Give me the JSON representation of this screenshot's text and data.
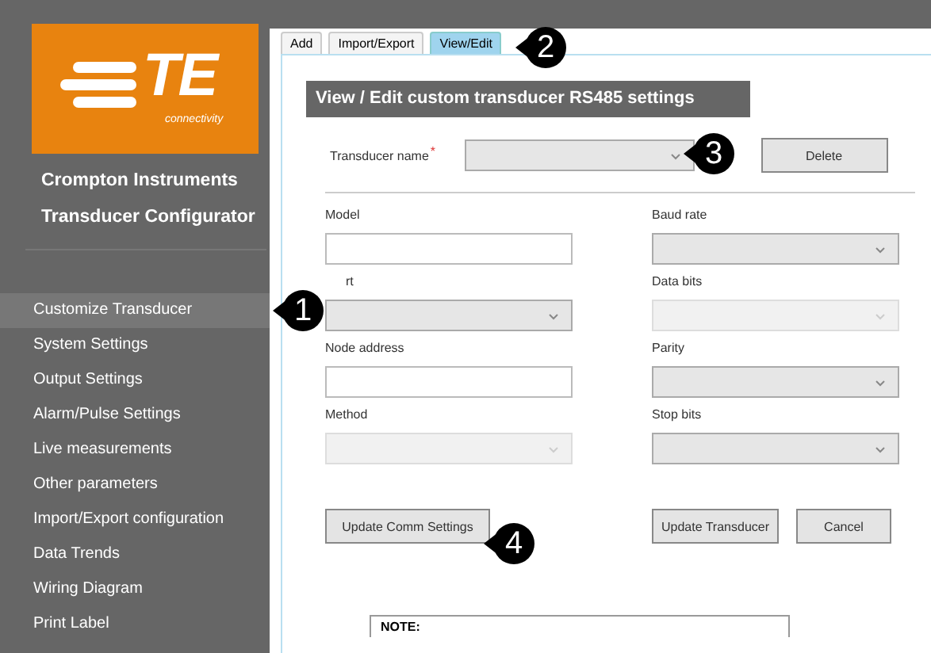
{
  "logo": {
    "mark": "TE",
    "tagline": "connectivity"
  },
  "sidebar": {
    "titles": [
      "Crompton Instruments",
      "Transducer Configurator"
    ],
    "items": [
      {
        "label": "Customize Transducer",
        "selected": true
      },
      {
        "label": "System Settings",
        "selected": false
      },
      {
        "label": "Output Settings",
        "selected": false
      },
      {
        "label": "Alarm/Pulse Settings",
        "selected": false
      },
      {
        "label": "Live measurements",
        "selected": false
      },
      {
        "label": "Other parameters",
        "selected": false
      },
      {
        "label": "Import/Export configuration",
        "selected": false
      },
      {
        "label": "Data Trends",
        "selected": false
      },
      {
        "label": "Wiring Diagram",
        "selected": false
      },
      {
        "label": "Print Label",
        "selected": false
      }
    ]
  },
  "tabs": [
    {
      "label": "Add",
      "selected": false
    },
    {
      "label": "Import/Export",
      "selected": false
    },
    {
      "label": "View/Edit",
      "selected": true
    }
  ],
  "header": "View / Edit custom transducer RS485 settings",
  "transducer_name": {
    "label": "Transducer name",
    "required_mark": "*",
    "button": "Delete"
  },
  "fields": [
    {
      "label": "Model",
      "kind": "text",
      "disabled": false
    },
    {
      "label": "Baud rate",
      "kind": "select",
      "disabled": false
    },
    {
      "label": "rt",
      "kind": "select",
      "disabled": false
    },
    {
      "label": "Data bits",
      "kind": "select",
      "disabled": true
    },
    {
      "label": "Node address",
      "kind": "text",
      "disabled": false
    },
    {
      "label": "Parity",
      "kind": "select",
      "disabled": false
    },
    {
      "label": "Method",
      "kind": "select",
      "disabled": true
    },
    {
      "label": "Stop bits",
      "kind": "select",
      "disabled": false
    }
  ],
  "buttons": {
    "update_comm": "Update Comm Settings",
    "update_transducer": "Update Transducer",
    "cancel": "Cancel"
  },
  "note": "NOTE:",
  "callouts": [
    "1",
    "2",
    "3",
    "4"
  ]
}
